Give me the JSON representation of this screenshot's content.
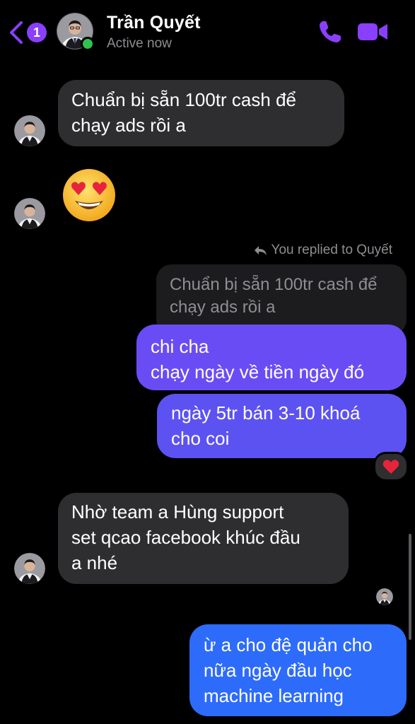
{
  "header": {
    "back_badge": "1",
    "contact_name": "Trần Quyết",
    "status": "Active now",
    "accent_color": "#8a3ffc",
    "online_color": "#31c24d",
    "icons": {
      "back": "chevron-left-icon",
      "call": "phone-icon",
      "video": "video-camera-icon"
    }
  },
  "messages": [
    {
      "sender": "contact",
      "lines": [
        "Chuẩn bị sẵn 100tr cash để",
        "chạy ads rồi a"
      ]
    },
    {
      "sender": "contact",
      "emoji": "heart-eyes-emoji"
    },
    {
      "sender": "me",
      "reply_label": "You replied to Quyết",
      "quoted_lines": [
        "Chuẩn bị sẵn 100tr cash để",
        "chạy ads rồi a"
      ],
      "lines": [
        "chi cha",
        "chạy ngày về tiền ngày đó"
      ]
    },
    {
      "sender": "me",
      "lines": [
        "ngày 5tr bán 3-10 khoá",
        "cho coi"
      ],
      "reaction": "red-heart-icon"
    },
    {
      "sender": "contact",
      "lines": [
        "Nhờ team a Hùng support",
        "set qcao facebook khúc đầu",
        "a nhé"
      ]
    },
    {
      "sender": "me",
      "lines": [
        "ừ a cho đệ quản cho",
        "nữa ngày đầu học",
        "machine learning"
      ]
    }
  ],
  "colors": {
    "incoming_bubble": "#2e2e30",
    "outgoing_purple": "#6a4cf5",
    "outgoing_violet": "#5c52f2",
    "outgoing_blue": "#2d6bfb",
    "quoted_bubble": "#1c1c1e"
  }
}
